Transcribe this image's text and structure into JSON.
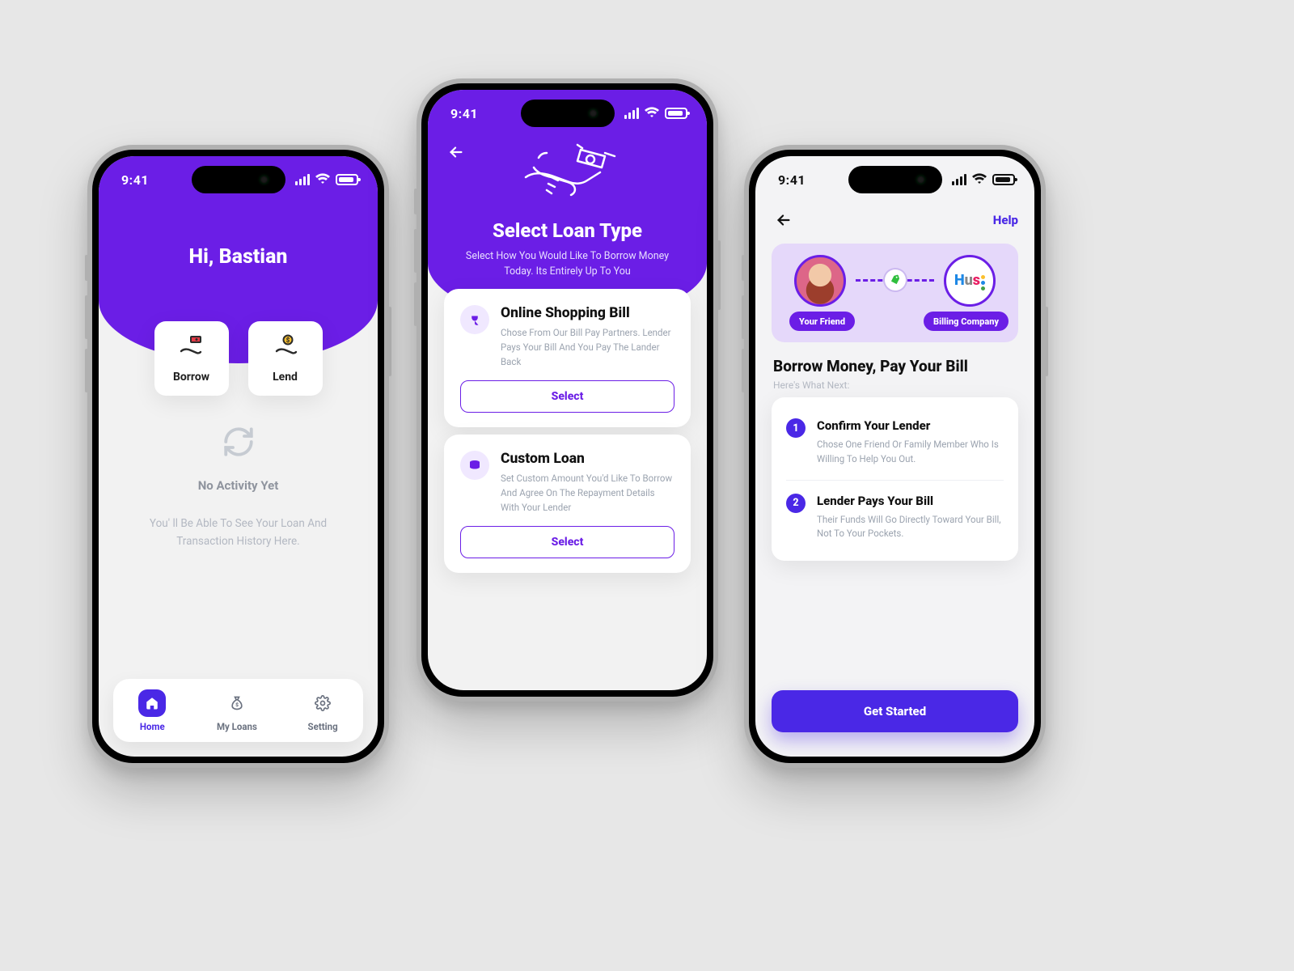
{
  "status": {
    "time": "9:41"
  },
  "phone1": {
    "greeting": "Hi, Bastian",
    "tiles": {
      "borrow": "Borrow",
      "lend": "Lend"
    },
    "activity": {
      "title": "No Activity Yet",
      "sub": "You' ll Be Able To See Your Loan And Transaction History Here."
    },
    "tabs": {
      "home": "Home",
      "myloans": "My Loans",
      "setting": "Setting"
    }
  },
  "phone2": {
    "title": "Select Loan Type",
    "subtitle": "Select How You Would Like To Borrow Money Today. Its Entirely Up To You",
    "select_label": "Select",
    "card1": {
      "title": "Online Shopping Bill",
      "desc": "Chose From Our Bill Pay Partners. Lender Pays Your Bill And You Pay The Lander Back"
    },
    "card2": {
      "title": "Custom Loan",
      "desc": "Set Custom Amount You'd Like To Borrow And Agree On The Repayment Details With Your Lender"
    }
  },
  "phone3": {
    "help": "Help",
    "hero": {
      "friend": "Your Friend",
      "company": "Billing Company",
      "brand": "Hus"
    },
    "section_title": "Borrow Money, Pay Your Bill",
    "section_sub": "Here's What Next:",
    "steps": [
      {
        "num": "1",
        "title": "Confirm Your Lender",
        "desc": "Chose One Friend Or Family Member Who Is Willing To Help You Out."
      },
      {
        "num": "2",
        "title": "Lender Pays Your Bill",
        "desc": "Their Funds Will Go Directly Toward Your Bill, Not To Your Pockets."
      }
    ],
    "cta": "Get Started"
  }
}
